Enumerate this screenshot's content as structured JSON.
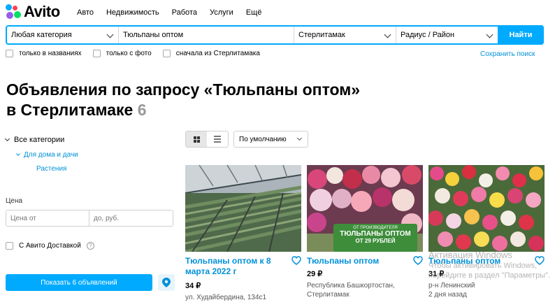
{
  "logo": {
    "text": "Avito"
  },
  "nav": [
    "Авто",
    "Недвижимость",
    "Работа",
    "Услуги",
    "Ещё"
  ],
  "search": {
    "category": "Любая категория",
    "query": "Тюльпаны оптом",
    "city": "Стерлитамак",
    "radius": "Радиус / Район",
    "button": "Найти"
  },
  "filters": [
    "только в названиях",
    "только с фото",
    "сначала из Стерлитамака"
  ],
  "save_search": "Сохранить поиск",
  "heading": {
    "line1": "Объявления по запросу «Тюльпаны оптом»",
    "line2": "в Стерлитамаке",
    "count": "6"
  },
  "sidebar": {
    "all_categories": "Все категории",
    "subcategory": "Для дома и дачи",
    "leaf": "Растения",
    "price_label": "Цена",
    "price_from_placeholder": "Цена от",
    "price_to_placeholder": "до, руб.",
    "delivery": "С Авито Доставкой",
    "help": "?",
    "show_button": "Показать 6 объявлений"
  },
  "sort": "По умолчанию",
  "cards": [
    {
      "title": "Тюльпаны оптом к 8 марта 2022 г",
      "price": "34 ₽",
      "addr1": "ул. Худайбердина, 134с1",
      "addr2": ""
    },
    {
      "title": "Тюльпаны оптом",
      "price": "29 ₽",
      "addr1": "Республика Башкортостан,",
      "addr2": "Стерлитамак",
      "banner1": "ОТ ПРОИЗВОДИТЕЛЯ",
      "banner2": "ТЮЛЬПАНЫ ОПТОМ",
      "banner3": "ОТ 29 РУБЛЕЙ"
    },
    {
      "title": "Тюльпаны оптом",
      "price": "31 ₽",
      "addr1": "р-н Ленинский",
      "addr2": "2 дня назад"
    }
  ],
  "watermark": {
    "line1": "Активация Windows",
    "line2": "Чтобы активировать Windows,",
    "line3": "перейдите в раздел \"Параметры\"."
  },
  "colors": {
    "accent": "#00aaff",
    "link": "#0091d9"
  }
}
